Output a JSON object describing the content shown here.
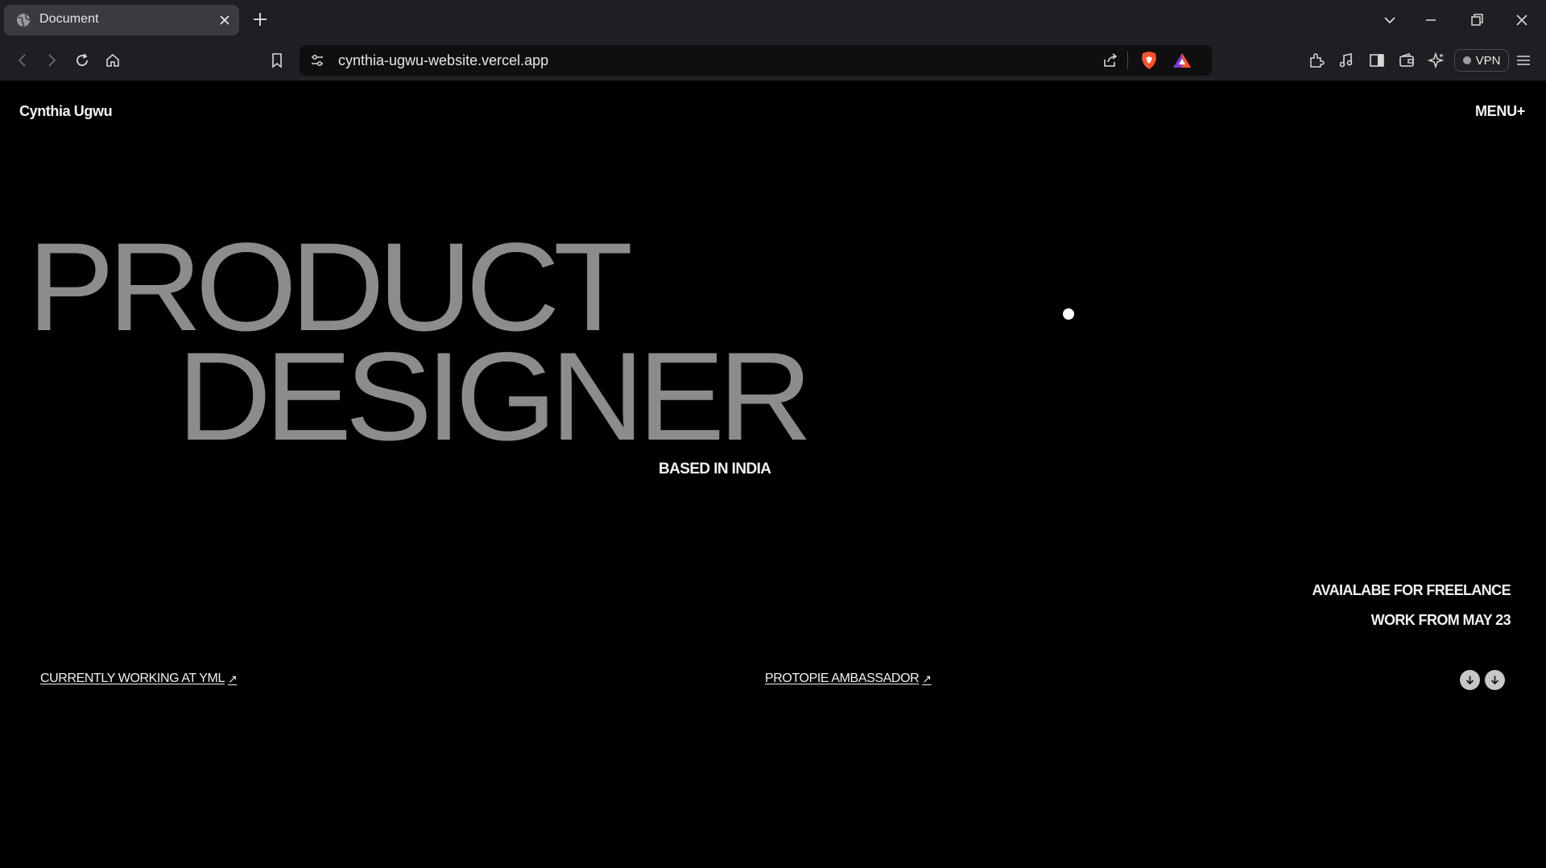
{
  "browser": {
    "tab": {
      "title": "Document",
      "favicon": "globe-icon"
    },
    "url": "cynthia-ugwu-website.vercel.app",
    "vpn_label": "VPN"
  },
  "site": {
    "brand": "Cynthia Ugwu",
    "menu_label": "MENU+",
    "headline_line1": "PRODUCT",
    "headline_line2": "DESIGNER",
    "location": "BASED IN INDIA",
    "availability_line1": "AVAIALABE FOR FREELANCE",
    "availability_line2": "WORK FROM MAY 23",
    "link_work": "CURRENTLY WORKING AT YML",
    "link_ambassador": "PROTOPIE AMBASSADOR",
    "link_arrow": "↗"
  },
  "colors": {
    "background": "#000000",
    "headline": "#8c8c8c",
    "text": "#f2f2f2",
    "chrome": "#1f1f23",
    "brave_orange": "#fb542b"
  }
}
